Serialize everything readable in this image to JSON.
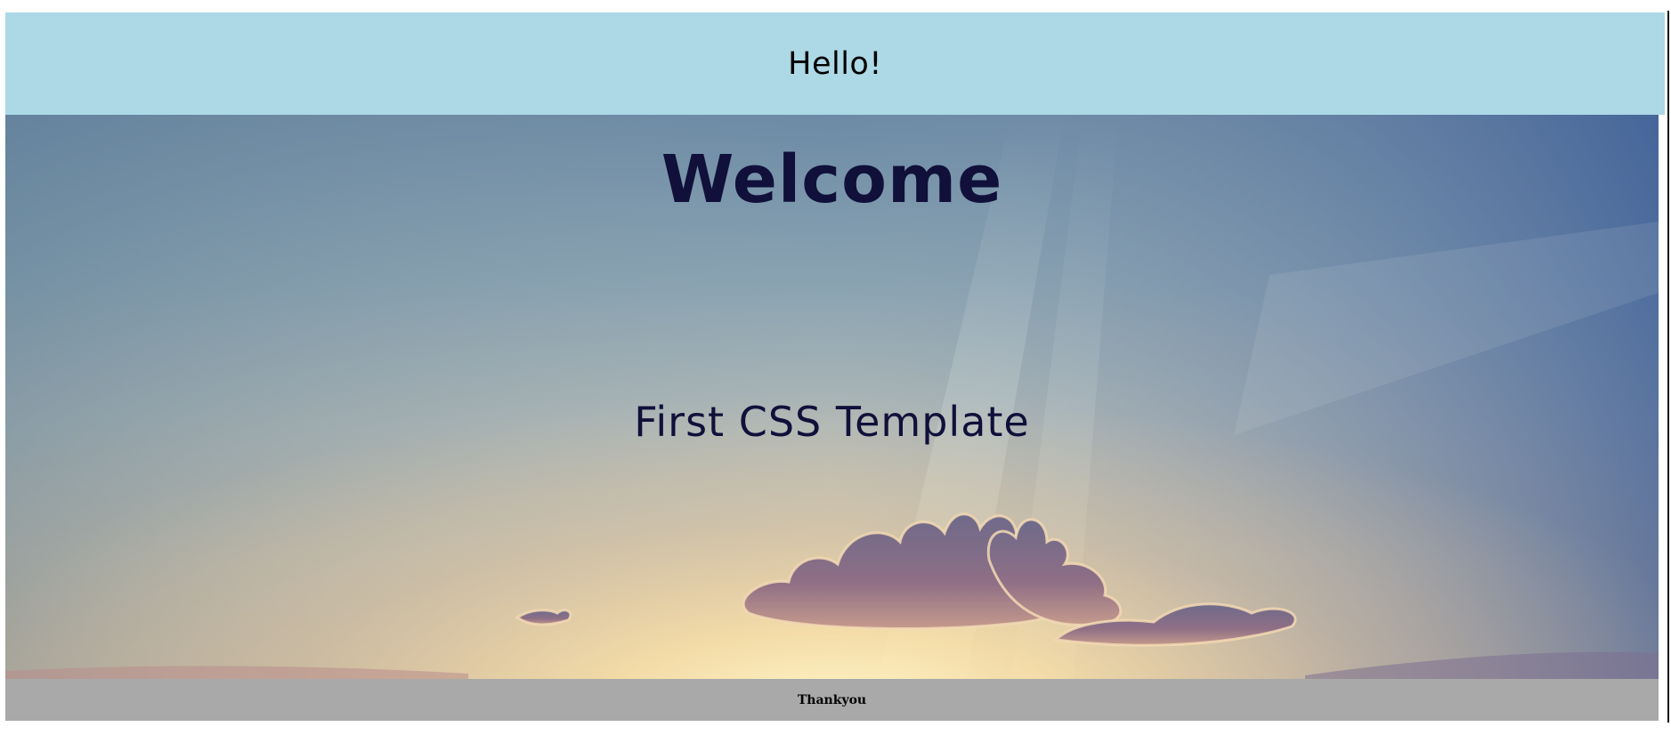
{
  "header": {
    "title": "Hello!",
    "background_color": "#add8e6"
  },
  "hero": {
    "heading": "Welcome",
    "subheading": "First CSS Template",
    "text_color": "#10103a",
    "background_image": "sky-with-sun-rays-and-clouds"
  },
  "footer": {
    "text": "Thankyou",
    "background_color": "#a9a9a9"
  }
}
